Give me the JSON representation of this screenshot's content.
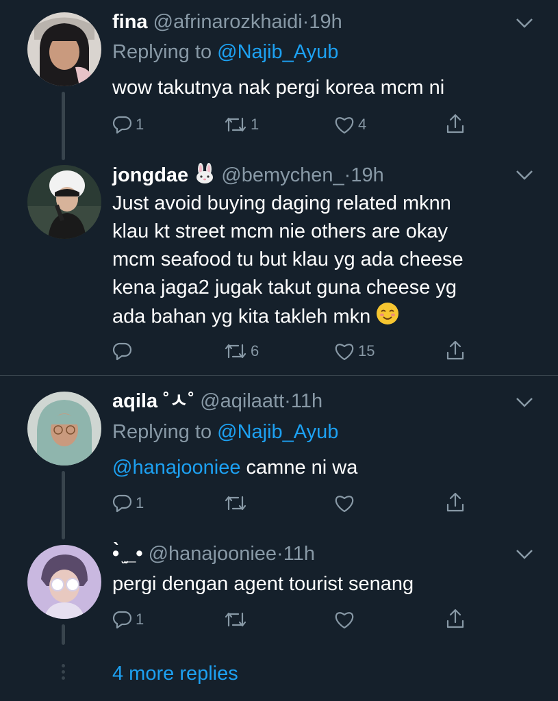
{
  "tweets": [
    {
      "name": "fina",
      "handle": "@afrinarozkhaidi",
      "sep": "·",
      "time": "19h",
      "replying_prefix": "Replying to",
      "replying_to": "@Najib_Ayub",
      "text": "wow takutnya nak pergi korea mcm ni",
      "reply_count": "1",
      "retweet_count": "1",
      "like_count": "4"
    },
    {
      "name": "jongdae",
      "name_emoji": "rabbit-face-emoji",
      "handle": "@bemychen_",
      "sep": "·",
      "time": "19h",
      "lines": [
        "Just avoid buying daging related mknn",
        "klau kt street mcm nie others are okay",
        "mcm seafood tu but klau yg ada cheese",
        "kena jaga2 jugak takut guna cheese yg",
        "ada bahan yg kita takleh mkn"
      ],
      "line_emoji": "smiling-face-emoji",
      "retweet_count": "6",
      "like_count": "15"
    },
    {
      "name": "aqila",
      "name_suffix": "˚ㅅ˚",
      "handle": "@aqilaatt",
      "sep": "·",
      "time": "11h",
      "replying_prefix": "Replying to",
      "replying_to": "@Najib_Ayub",
      "mention": "@hanajooniee",
      "text": " camne ni wa",
      "reply_count": "1"
    },
    {
      "name": "•̀ ̫_•",
      "handle": "@hanajooniee",
      "sep": "·",
      "time": "11h",
      "text": "pergi dengan agent tourist senang",
      "reply_count": "1"
    }
  ],
  "more_replies": "4 more replies",
  "colors": {
    "background": "#15202b",
    "muted": "#8899a6",
    "link": "#1da1f2",
    "line": "#38444d"
  }
}
